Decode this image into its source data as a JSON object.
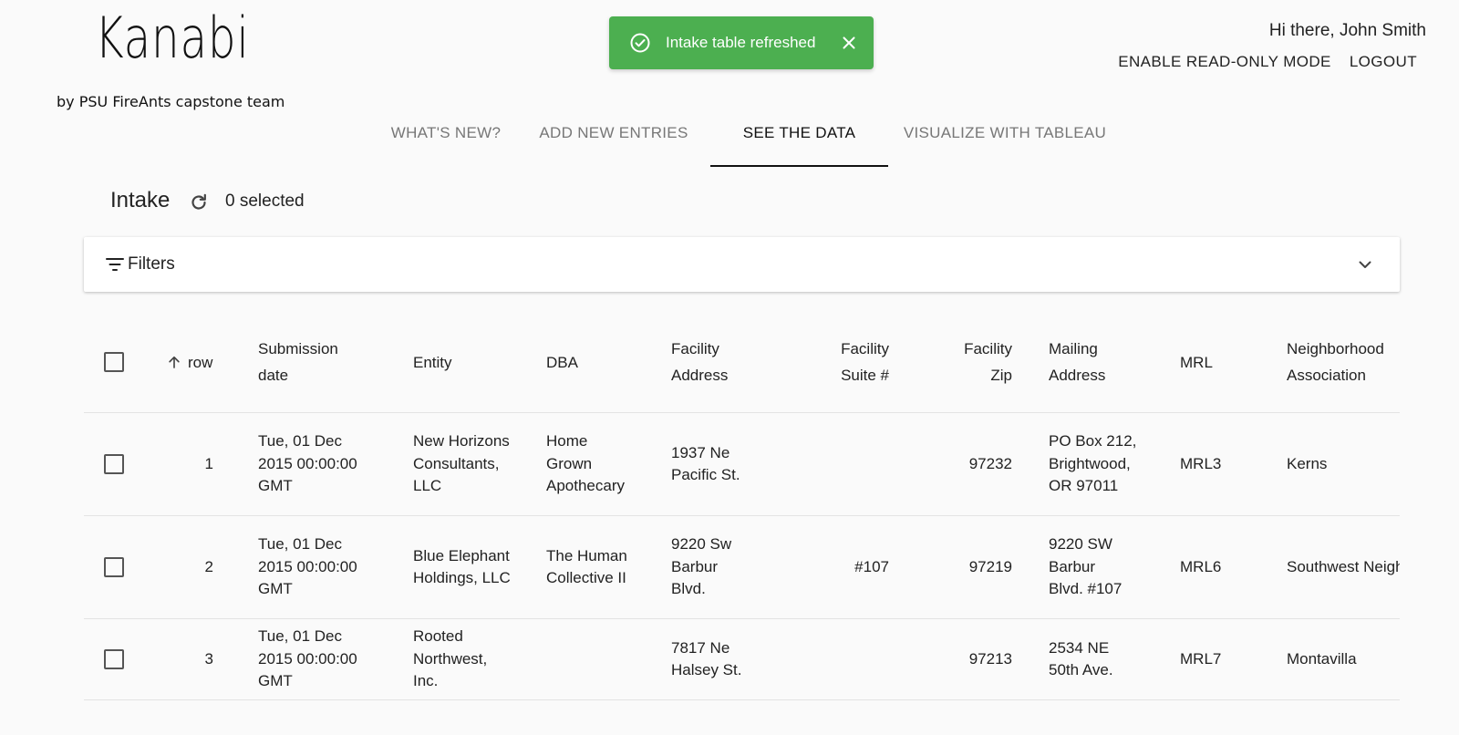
{
  "brand": {
    "logo": "Kanabi",
    "subtitle": "by PSU FireAnts capstone team"
  },
  "toast": {
    "message": "Intake table refreshed",
    "color": "#4caf50"
  },
  "user": {
    "greeting": "Hi there, John Smith",
    "readonly_label": "ENABLE READ-ONLY MODE",
    "logout_label": "LOGOUT"
  },
  "tabs": [
    {
      "label": "WHAT'S NEW?",
      "active": false
    },
    {
      "label": "ADD NEW ENTRIES",
      "active": false
    },
    {
      "label": "SEE THE DATA",
      "active": true
    },
    {
      "label": "VISUALIZE WITH TABLEAU",
      "active": false
    }
  ],
  "intake": {
    "title": "Intake",
    "selected": "0 selected"
  },
  "filters": {
    "label": "Filters"
  },
  "table": {
    "headers": {
      "row": "row",
      "submission_date": "Submission date",
      "entity": "Entity",
      "dba": "DBA",
      "facility_address": "Facility Address",
      "facility_suite": "Facility Suite #",
      "facility_zip": "Facility Zip",
      "mailing_address": "Mailing Address",
      "mrl": "MRL",
      "neighborhood": "Neighborhood Association"
    },
    "rows": [
      {
        "row": "1",
        "submission_date": "Tue, 01 Dec 2015 00:00:00 GMT",
        "entity": "New Horizons Consultants, LLC",
        "dba": "Home Grown Apothecary",
        "facility_address": "1937 Ne Pacific St.",
        "facility_suite": "",
        "facility_zip": "97232",
        "mailing_address": "PO Box 212, Brightwood, OR 97011",
        "mrl": "MRL3",
        "neighborhood": "Kerns"
      },
      {
        "row": "2",
        "submission_date": "Tue, 01 Dec 2015 00:00:00 GMT",
        "entity": "Blue Elephant Holdings, LLC",
        "dba": "The Human Collective II",
        "facility_address": "9220 Sw Barbur Blvd.",
        "facility_suite": "#107",
        "facility_zip": "97219",
        "mailing_address": "9220 SW Barbur Blvd. #107",
        "mrl": "MRL6",
        "neighborhood": "Southwest Neighborhood Inc."
      },
      {
        "row": "3",
        "submission_date": "Tue, 01 Dec 2015 00:00:00 GMT",
        "entity": "Rooted Northwest, Inc.",
        "dba": "",
        "facility_address": "7817 Ne Halsey St.",
        "facility_suite": "",
        "facility_zip": "97213",
        "mailing_address": "2534 NE 50th Ave.",
        "mrl": "MRL7",
        "neighborhood": "Montavilla"
      }
    ]
  }
}
